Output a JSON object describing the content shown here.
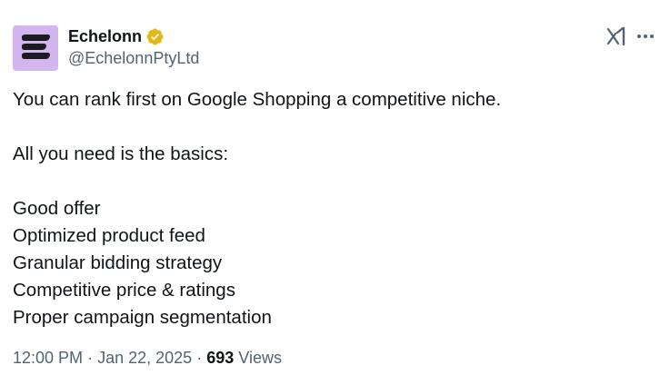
{
  "author": {
    "name": "Echelonn",
    "handle": "@EchelonnPtyLtd",
    "verified_badge": "gold-verified-badge-icon",
    "avatar_color": "#d3b5ef"
  },
  "actions": {
    "grok_icon": "grok-icon",
    "more_icon": "more-icon"
  },
  "body": {
    "line1": "You can rank first on Google Shopping a competitive niche.",
    "line2": "All you need is the basics:",
    "list": [
      "Good offer",
      "Optimized product feed",
      "Granular bidding strategy",
      "Competitive price & ratings",
      "Proper campaign segmentation"
    ]
  },
  "meta": {
    "time": "12:00 PM",
    "separator": "·",
    "date": "Jan 22, 2025",
    "views_count": "693",
    "views_label": "Views"
  },
  "colors": {
    "text_primary": "#0f1419",
    "text_secondary": "#536471",
    "badge_gold": "#e2b719"
  }
}
